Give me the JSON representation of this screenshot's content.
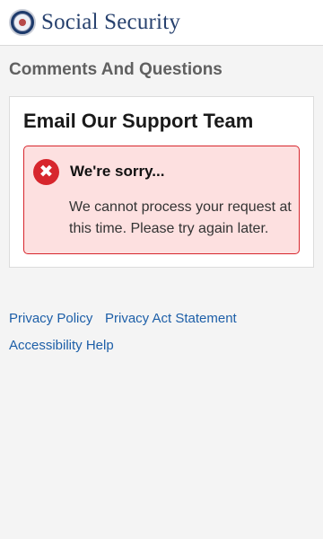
{
  "header": {
    "brand": "Social Security",
    "logo_icon": "ssa-seal-icon"
  },
  "page_title": "Comments And Questions",
  "card": {
    "title": "Email Our Support Team",
    "alert": {
      "icon": "error-x-icon",
      "icon_glyph": "✖",
      "heading": "We're sorry...",
      "message": "We cannot process your request at this time. Please try again later.",
      "color": "#d7262d"
    }
  },
  "footer": {
    "links": [
      {
        "label": "Privacy Policy"
      },
      {
        "label": "Privacy Act Statement"
      },
      {
        "label": "Accessibility Help"
      }
    ]
  }
}
